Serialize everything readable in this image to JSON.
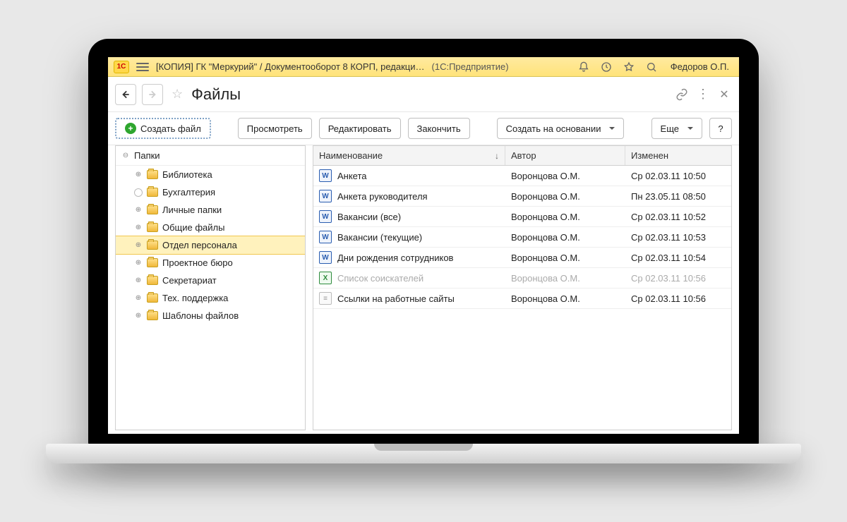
{
  "titlebar": {
    "app_title": "[КОПИЯ] ГК \"Меркурий\" / Документооборот 8 КОРП, редакци…",
    "platform": "(1С:Предприятие)",
    "user": "Федоров О.П."
  },
  "page": {
    "title": "Файлы"
  },
  "toolbar": {
    "create_file": "Создать файл",
    "view": "Просмотреть",
    "edit": "Редактировать",
    "finish": "Закончить",
    "create_based_on": "Создать на основании",
    "more": "Еще",
    "help": "?"
  },
  "tree": {
    "root_label": "Папки",
    "items": [
      {
        "label": "Библиотека",
        "expandable": true,
        "selected": false
      },
      {
        "label": "Бухгалтерия",
        "expandable": false,
        "selected": false
      },
      {
        "label": "Личные папки",
        "expandable": true,
        "selected": false
      },
      {
        "label": "Общие файлы",
        "expandable": true,
        "selected": false
      },
      {
        "label": "Отдел персонала",
        "expandable": true,
        "selected": true
      },
      {
        "label": "Проектное бюро",
        "expandable": true,
        "selected": false
      },
      {
        "label": "Секретариат",
        "expandable": true,
        "selected": false
      },
      {
        "label": "Тех. поддержка",
        "expandable": true,
        "selected": false
      },
      {
        "label": "Шаблоны файлов",
        "expandable": true,
        "selected": false
      }
    ]
  },
  "columns": {
    "name": "Наименование",
    "author": "Автор",
    "date": "Изменен"
  },
  "files": [
    {
      "icon": "word",
      "name": "Анкета",
      "author": "Воронцова О.М.",
      "date": "Ср 02.03.11 10:50",
      "muted": false
    },
    {
      "icon": "word",
      "name": "Анкета руководителя",
      "author": "Воронцова О.М.",
      "date": "Пн 23.05.11 08:50",
      "muted": false
    },
    {
      "icon": "word",
      "name": "Вакансии (все)",
      "author": "Воронцова О.М.",
      "date": "Ср 02.03.11 10:52",
      "muted": false
    },
    {
      "icon": "word",
      "name": "Вакансии (текущие)",
      "author": "Воронцова О.М.",
      "date": "Ср 02.03.11 10:53",
      "muted": false
    },
    {
      "icon": "word",
      "name": "Дни рождения сотрудников",
      "author": "Воронцова О.М.",
      "date": "Ср 02.03.11 10:54",
      "muted": false
    },
    {
      "icon": "excel",
      "name": "Список соискателей",
      "author": "Воронцова О.М.",
      "date": "Ср 02.03.11 10:56",
      "muted": true
    },
    {
      "icon": "txt",
      "name": "Ссылки на работные сайты",
      "author": "Воронцова О.М.",
      "date": "Ср 02.03.11 10:56",
      "muted": false
    }
  ]
}
